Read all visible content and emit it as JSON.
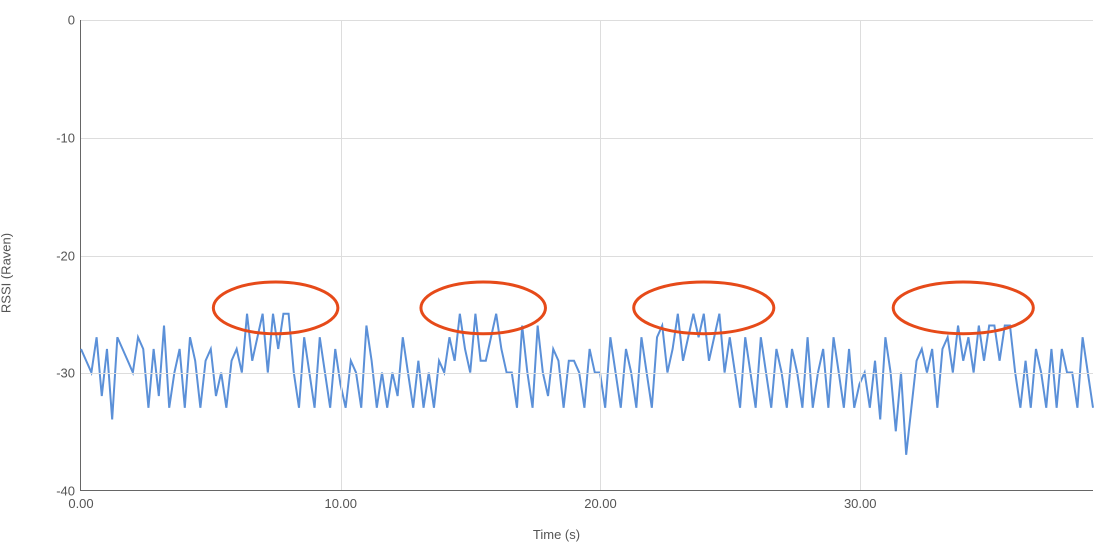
{
  "chart_data": {
    "type": "line",
    "title": "",
    "xlabel": "Time (s)",
    "ylabel": "RSSI (Raven)",
    "xlim": [
      0,
      39
    ],
    "ylim": [
      -40,
      0
    ],
    "xticks": [
      0,
      10,
      20,
      30
    ],
    "xtick_labels": [
      "0.00",
      "10.00",
      "20.00",
      "30.00"
    ],
    "yticks": [
      0,
      -10,
      -20,
      -30,
      -40
    ],
    "ytick_labels": [
      "0",
      "-10",
      "-20",
      "-30",
      "-40"
    ],
    "grid": true,
    "series": [
      {
        "name": "rssi",
        "color": "#5b90d8",
        "x": [
          0.0,
          0.2,
          0.4,
          0.6,
          0.8,
          1.0,
          1.2,
          1.4,
          1.6,
          1.8,
          2.0,
          2.2,
          2.4,
          2.6,
          2.8,
          3.0,
          3.2,
          3.4,
          3.6,
          3.8,
          4.0,
          4.2,
          4.4,
          4.6,
          4.8,
          5.0,
          5.2,
          5.4,
          5.6,
          5.8,
          6.0,
          6.2,
          6.4,
          6.6,
          6.8,
          7.0,
          7.2,
          7.4,
          7.6,
          7.8,
          8.0,
          8.2,
          8.4,
          8.6,
          8.8,
          9.0,
          9.2,
          9.4,
          9.6,
          9.8,
          10.0,
          10.2,
          10.4,
          10.6,
          10.8,
          11.0,
          11.2,
          11.4,
          11.6,
          11.8,
          12.0,
          12.2,
          12.4,
          12.6,
          12.8,
          13.0,
          13.2,
          13.4,
          13.6,
          13.8,
          14.0,
          14.2,
          14.4,
          14.6,
          14.8,
          15.0,
          15.2,
          15.4,
          15.6,
          15.8,
          16.0,
          16.2,
          16.4,
          16.6,
          16.8,
          17.0,
          17.2,
          17.4,
          17.6,
          17.8,
          18.0,
          18.2,
          18.4,
          18.6,
          18.8,
          19.0,
          19.2,
          19.4,
          19.6,
          19.8,
          20.0,
          20.2,
          20.4,
          20.6,
          20.8,
          21.0,
          21.2,
          21.4,
          21.6,
          21.8,
          22.0,
          22.2,
          22.4,
          22.6,
          22.8,
          23.0,
          23.2,
          23.4,
          23.6,
          23.8,
          24.0,
          24.2,
          24.4,
          24.6,
          24.8,
          25.0,
          25.2,
          25.4,
          25.6,
          25.8,
          26.0,
          26.2,
          26.4,
          26.6,
          26.8,
          27.0,
          27.2,
          27.4,
          27.6,
          27.8,
          28.0,
          28.2,
          28.4,
          28.6,
          28.8,
          29.0,
          29.2,
          29.4,
          29.6,
          29.8,
          30.0,
          30.2,
          30.4,
          30.6,
          30.8,
          31.0,
          31.2,
          31.4,
          31.6,
          31.8,
          32.0,
          32.2,
          32.4,
          32.6,
          32.8,
          33.0,
          33.2,
          33.4,
          33.6,
          33.8,
          34.0,
          34.2,
          34.4,
          34.6,
          34.8,
          35.0,
          35.2,
          35.4,
          35.6,
          35.8,
          36.0,
          36.2,
          36.4,
          36.6,
          36.8,
          37.0,
          37.2,
          37.4,
          37.6,
          37.8,
          38.0,
          38.2,
          38.4,
          38.6,
          38.8,
          39.0
        ],
        "y": [
          -28,
          -29,
          -30,
          -27,
          -32,
          -28,
          -34,
          -27,
          -28,
          -29,
          -30,
          -27,
          -28,
          -33,
          -28,
          -32,
          -26,
          -33,
          -30,
          -28,
          -33,
          -27,
          -29,
          -33,
          -29,
          -28,
          -32,
          -30,
          -33,
          -29,
          -28,
          -30,
          -25,
          -29,
          -27,
          -25,
          -30,
          -25,
          -28,
          -25,
          -25,
          -30,
          -33,
          -27,
          -30,
          -33,
          -27,
          -30,
          -33,
          -28,
          -31,
          -33,
          -29,
          -30,
          -33,
          -26,
          -29,
          -33,
          -30,
          -33,
          -30,
          -32,
          -27,
          -30,
          -33,
          -29,
          -33,
          -30,
          -33,
          -29,
          -30,
          -27,
          -29,
          -25,
          -28,
          -30,
          -25,
          -29,
          -29,
          -27,
          -25,
          -28,
          -30,
          -30,
          -33,
          -26,
          -30,
          -33,
          -26,
          -30,
          -32,
          -28,
          -29,
          -33,
          -29,
          -29,
          -30,
          -33,
          -28,
          -30,
          -30,
          -33,
          -27,
          -30,
          -33,
          -28,
          -30,
          -33,
          -27,
          -30,
          -33,
          -27,
          -26,
          -30,
          -28,
          -25,
          -29,
          -27,
          -25,
          -27,
          -25,
          -29,
          -27,
          -25,
          -30,
          -27,
          -30,
          -33,
          -27,
          -30,
          -33,
          -27,
          -30,
          -33,
          -28,
          -30,
          -33,
          -28,
          -30,
          -33,
          -27,
          -33,
          -30,
          -28,
          -33,
          -27,
          -30,
          -33,
          -28,
          -33,
          -31,
          -30,
          -33,
          -29,
          -34,
          -27,
          -30,
          -35,
          -30,
          -37,
          -33,
          -29,
          -28,
          -30,
          -28,
          -33,
          -28,
          -27,
          -30,
          -26,
          -29,
          -27,
          -30,
          -26,
          -29,
          -26,
          -26,
          -29,
          -26,
          -26,
          -30,
          -33,
          -29,
          -33,
          -28,
          -30,
          -33,
          -28,
          -33,
          -28,
          -30,
          -30,
          -33,
          -27,
          -30,
          -33
        ]
      }
    ],
    "annotations": [
      {
        "type": "ellipse",
        "cx": 7.5,
        "cy": -24.5,
        "rx": 2.4,
        "ry": 2.2,
        "color": "#e64a19"
      },
      {
        "type": "ellipse",
        "cx": 15.5,
        "cy": -24.5,
        "rx": 2.4,
        "ry": 2.2,
        "color": "#e64a19"
      },
      {
        "type": "ellipse",
        "cx": 24.0,
        "cy": -24.5,
        "rx": 2.7,
        "ry": 2.2,
        "color": "#e64a19"
      },
      {
        "type": "ellipse",
        "cx": 34.0,
        "cy": -24.5,
        "rx": 2.7,
        "ry": 2.2,
        "color": "#e64a19"
      }
    ]
  }
}
